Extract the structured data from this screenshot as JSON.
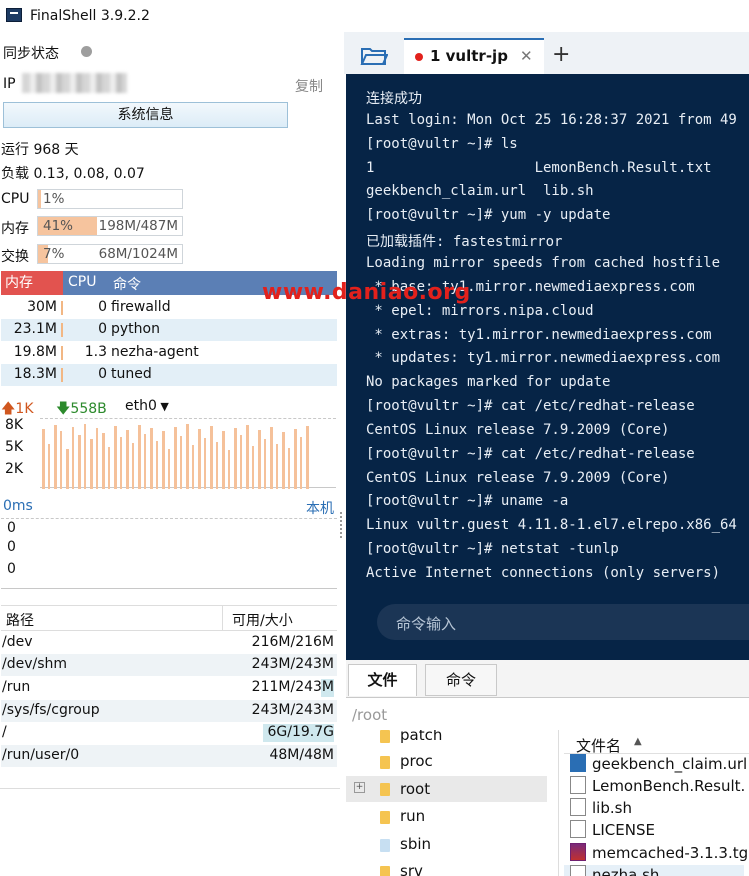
{
  "app": {
    "title": "FinalShell 3.9.2.2"
  },
  "sync": {
    "label": "同步状态"
  },
  "ip": {
    "label": "IP",
    "copy": "复制"
  },
  "sysinfo": {
    "label": "系统信息"
  },
  "uptime": {
    "text": "运行 968 天"
  },
  "load": {
    "text": "负载 0.13, 0.08, 0.07"
  },
  "resources": {
    "cpu": {
      "label": "CPU",
      "pct": "1%",
      "fill": 0.01
    },
    "mem": {
      "label": "内存",
      "pct": "41%",
      "size": "198M/487M",
      "fill": 0.41
    },
    "swap": {
      "label": "交换",
      "pct": "7%",
      "size": "68M/1024M",
      "fill": 0.07
    }
  },
  "processes": {
    "headers": {
      "mem": "内存",
      "cpu": "CPU",
      "cmd": "命令"
    },
    "rows": [
      {
        "mem": "30M",
        "cpu": "0",
        "cmd": "firewalld"
      },
      {
        "mem": "23.1M",
        "cpu": "0",
        "cmd": "python"
      },
      {
        "mem": "19.8M",
        "cpu": "1.3",
        "cmd": "nezha-agent"
      },
      {
        "mem": "18.3M",
        "cpu": "0",
        "cmd": "tuned"
      }
    ]
  },
  "network": {
    "up": "1K",
    "down": "558B",
    "iface": "eth0",
    "ylabels": [
      "8K",
      "5K",
      "2K"
    ]
  },
  "ping": {
    "label": "0ms",
    "host": "本机",
    "values": [
      "0",
      "0",
      "0"
    ]
  },
  "disks": {
    "headers": {
      "path": "路径",
      "size": "可用/大小"
    },
    "rows": [
      {
        "path": "/dev",
        "size": "216M/216M"
      },
      {
        "path": "/dev/shm",
        "size": "243M/243M"
      },
      {
        "path": "/run",
        "size": "211M/243M"
      },
      {
        "path": "/sys/fs/cgroup",
        "size": "243M/243M"
      },
      {
        "path": "/",
        "size": "6G/19.7G"
      },
      {
        "path": "/run/user/0",
        "size": "48M/48M"
      }
    ]
  },
  "terminal": {
    "tab_label": "1 vultr-jp",
    "lines": [
      "连接成功",
      "Last login: Mon Oct 25 16:28:37 2021 from 49",
      "[root@vultr ~]# ls",
      "1                   LemonBench.Result.txt",
      "geekbench_claim.url  lib.sh",
      "[root@vultr ~]# yum -y update",
      "已加载插件: fastestmirror",
      "Loading mirror speeds from cached hostfile",
      " * base: ty1.mirror.newmediaexpress.com",
      " * epel: mirrors.nipa.cloud",
      " * extras: ty1.mirror.newmediaexpress.com",
      " * updates: ty1.mirror.newmediaexpress.com",
      "No packages marked for update",
      "[root@vultr ~]# cat /etc/redhat-release",
      "CentOS Linux release 7.9.2009 (Core)",
      "[root@vultr ~]# cat /etc/redhat-release",
      "CentOS Linux release 7.9.2009 (Core)",
      "[root@vultr ~]# uname -a",
      "Linux vultr.guest 4.11.8-1.el7.elrepo.x86_64",
      "[root@vultr ~]# netstat -tunlp",
      "Active Internet connections (only servers)"
    ],
    "input_placeholder": "命令输入"
  },
  "watermark": "www.daniao.org",
  "filebrowser": {
    "tabs": [
      "文件",
      "命令"
    ],
    "path": "/root",
    "tree": [
      "patch",
      "proc",
      "root",
      "run",
      "sbin",
      "srv"
    ],
    "files_header": "文件名",
    "files": [
      "geekbench_claim.url",
      "LemonBench.Result.",
      "lib.sh",
      "LICENSE",
      "memcached-3.1.3.tg",
      "nezha.sh"
    ]
  }
}
